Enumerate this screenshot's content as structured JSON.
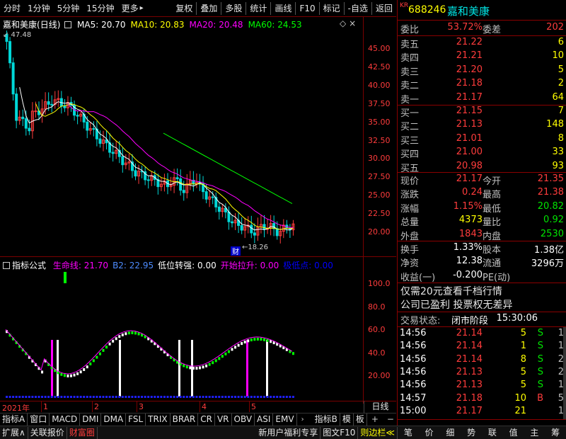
{
  "toolbar": {
    "left": [
      "分时",
      "1分钟",
      "5分钟",
      "15分钟",
      "更多"
    ],
    "more_arrow": "▸",
    "right": [
      "复权",
      "叠加",
      "多股",
      "统计",
      "画线",
      "F10",
      "标记",
      "-自选",
      "返回"
    ]
  },
  "header": {
    "stock": "嘉和美康",
    "period": "(日线)",
    "ma_labels": [
      {
        "text": "MA5: 20.70",
        "color": "#ffffff"
      },
      {
        "text": "MA10: 20.83",
        "color": "#ffff00"
      },
      {
        "text": "MA20: 20.48",
        "color": "#ff00ff"
      },
      {
        "text": "MA60: 24.53",
        "color": "#00ff00"
      }
    ],
    "high_label": "47.48",
    "low_label": "18.26",
    "cai_label": "财"
  },
  "price_axis": [
    "45.00",
    "42.50",
    "40.00",
    "37.50",
    "35.00",
    "32.50",
    "30.00",
    "27.50",
    "25.00",
    "22.50",
    "20.00"
  ],
  "indicator": {
    "title": "指标公式",
    "items": [
      {
        "text": "生命线: 21.70",
        "color": "#ff00ff"
      },
      {
        "text": "B2: 22.95",
        "color": "#4d8cff"
      },
      {
        "text": "低位转强: 0.00",
        "color": "#ffffff"
      },
      {
        "text": "开始拉升: 0.00",
        "color": "#ff00ff"
      },
      {
        "text": "极低点: 0.00",
        "color": "#0000ff"
      }
    ],
    "axis": [
      "100.0",
      "80.0",
      "60.0",
      "40.0",
      "20.00"
    ]
  },
  "timeline": {
    "year": "2021年",
    "months": [
      "1",
      "2",
      "3",
      "4",
      "5"
    ]
  },
  "indicator_tabs": [
    "指标A",
    "窗口",
    "MACD",
    "DMI",
    "DMA",
    "FSL",
    "TRIX",
    "BRAR",
    "CR",
    "VR",
    "OBV",
    "ASI",
    "EMV"
  ],
  "indicator_tabs_right": [
    "指标B",
    "模",
    "板"
  ],
  "rline": "日线",
  "bottom": {
    "left": [
      "扩展∧",
      "关联报价",
      "财富圈"
    ],
    "mid": [
      "新用户福利专享",
      "图文F10",
      "则边栏≪"
    ],
    "right": [
      "笔",
      "价",
      "细",
      "势",
      "联",
      "值",
      "主",
      "筹"
    ]
  },
  "quote": {
    "badge": "KR",
    "code": "688246",
    "name": "嘉和美康",
    "wei_bi": {
      "label": "委比",
      "value": "53.72%"
    },
    "wei_cha": {
      "label": "委差",
      "value": "202"
    },
    "sells": [
      {
        "label": "卖五",
        "price": "21.22",
        "vol": "6"
      },
      {
        "label": "卖四",
        "price": "21.21",
        "vol": "10"
      },
      {
        "label": "卖三",
        "price": "21.20",
        "vol": "5"
      },
      {
        "label": "卖二",
        "price": "21.18",
        "vol": "2"
      },
      {
        "label": "卖一",
        "price": "21.17",
        "vol": "64"
      }
    ],
    "buys": [
      {
        "label": "买一",
        "price": "21.15",
        "vol": "7"
      },
      {
        "label": "买二",
        "price": "21.13",
        "vol": "148"
      },
      {
        "label": "买三",
        "price": "21.01",
        "vol": "8"
      },
      {
        "label": "买四",
        "price": "21.00",
        "vol": "33"
      },
      {
        "label": "买五",
        "price": "20.98",
        "vol": "93"
      }
    ],
    "stats": [
      [
        {
          "label": "现价",
          "value": "21.17",
          "color": "#ff3c3c"
        },
        {
          "label": "今开",
          "value": "21.35",
          "color": "#ff3c3c"
        }
      ],
      [
        {
          "label": "涨跌",
          "value": "0.24",
          "color": "#ff3c3c"
        },
        {
          "label": "最高",
          "value": "21.38",
          "color": "#ff3c3c"
        }
      ],
      [
        {
          "label": "涨幅",
          "value": "1.15%",
          "color": "#ff3c3c"
        },
        {
          "label": "最低",
          "value": "20.82",
          "color": "#00e400"
        }
      ],
      [
        {
          "label": "总量",
          "value": "4373",
          "color": "#ffff00"
        },
        {
          "label": "量比",
          "value": "0.92",
          "color": "#00e400"
        }
      ],
      [
        {
          "label": "外盘",
          "value": "1843",
          "color": "#ff3c3c"
        },
        {
          "label": "内盘",
          "value": "2530",
          "color": "#00e400"
        }
      ]
    ],
    "stats2": [
      [
        {
          "label": "换手",
          "value": "1.33%",
          "color": "#ffffff"
        },
        {
          "label": "股本",
          "value": "1.38亿",
          "color": "#ffffff"
        }
      ],
      [
        {
          "label": "净资",
          "value": "12.38",
          "color": "#ffffff"
        },
        {
          "label": "流通",
          "value": "3296万",
          "color": "#ffffff"
        }
      ],
      [
        {
          "label": "收益(一)",
          "value": "-0.200",
          "color": "#ffffff"
        },
        {
          "label": "PE(动)",
          "value": "",
          "color": "#ffffff"
        }
      ]
    ],
    "notice1": "仅需20元查看千档行情",
    "notice2": "公司已盈利 投票权无差异",
    "status_label": "交易状态:",
    "status_value": "闭市阶段",
    "status_time": "15:30:06",
    "ticks": [
      {
        "time": "14:56",
        "price": "21.14",
        "color": "#ff3c3c",
        "vol": "5",
        "bs": "S",
        "bsc": "#00e400",
        "n": "1"
      },
      {
        "time": "14:56",
        "price": "21.14",
        "color": "#ff3c3c",
        "vol": "1",
        "bs": "S",
        "bsc": "#00e400",
        "n": "1"
      },
      {
        "time": "14:56",
        "price": "21.14",
        "color": "#ff3c3c",
        "vol": "8",
        "bs": "S",
        "bsc": "#00e400",
        "n": "2"
      },
      {
        "time": "14:56",
        "price": "21.13",
        "color": "#ff3c3c",
        "vol": "5",
        "bs": "S",
        "bsc": "#00e400",
        "n": "2"
      },
      {
        "time": "14:56",
        "price": "21.13",
        "color": "#ff3c3c",
        "vol": "5",
        "bs": "S",
        "bsc": "#00e400",
        "n": "1"
      },
      {
        "time": "14:57",
        "price": "21.18",
        "color": "#ff3c3c",
        "vol": "10",
        "bs": "B",
        "bsc": "#ff3c3c",
        "n": "5"
      },
      {
        "time": "15:00",
        "price": "21.17",
        "color": "#ff3c3c",
        "vol": "21",
        "bs": "",
        "bsc": "#ffffff",
        "n": "1"
      }
    ]
  }
}
